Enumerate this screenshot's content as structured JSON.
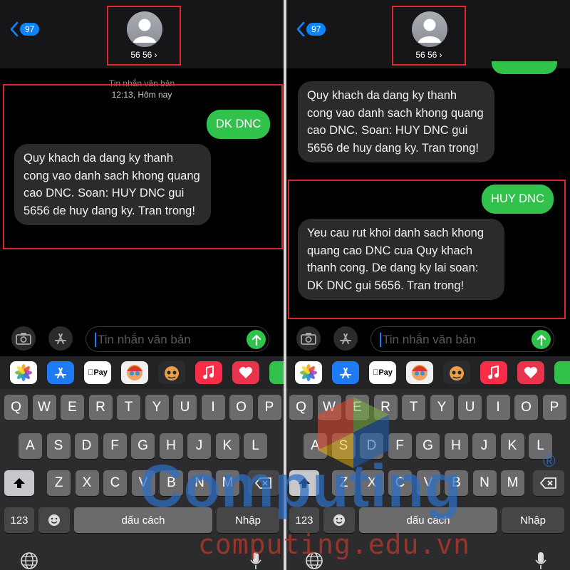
{
  "header": {
    "back_count": "97",
    "contact_name": "56 56 ›"
  },
  "conversation_meta": {
    "type_label": "Tin nhắn văn bản",
    "time": "12:13, Hôm nay"
  },
  "left_screen": {
    "messages": [
      {
        "direction": "outgoing",
        "text": "DK DNC"
      },
      {
        "direction": "incoming",
        "text": "Quy khach da dang ky thanh cong vao danh sach khong quang cao DNC. Soan: HUY DNC gui 5656 de huy dang ky. Tran trong!"
      }
    ]
  },
  "right_screen": {
    "messages": [
      {
        "direction": "incoming",
        "text": "Quy khach da dang ky thanh cong vao danh sach khong quang cao DNC. Soan: HUY DNC gui 5656 de huy dang ky. Tran trong!"
      },
      {
        "direction": "outgoing",
        "text": "HUY DNC"
      },
      {
        "direction": "incoming",
        "text": "Yeu cau rut khoi danh sach khong quang cao DNC cua Quy khach thanh cong. De dang ky lai soan: DK DNC gui 5656. Tran trong!"
      }
    ]
  },
  "composer": {
    "placeholder": "Tin nhắn văn bản"
  },
  "app_bar": {
    "applepay_label": "Pay"
  },
  "keyboard": {
    "row1": [
      "Q",
      "W",
      "E",
      "R",
      "T",
      "Y",
      "U",
      "I",
      "O",
      "P"
    ],
    "row2": [
      "A",
      "S",
      "D",
      "F",
      "G",
      "H",
      "J",
      "K",
      "L"
    ],
    "row3": [
      "Z",
      "X",
      "C",
      "V",
      "B",
      "N",
      "M"
    ],
    "numbers_key": "123",
    "space_label": "dấu cách",
    "return_label": "Nhập"
  },
  "watermark": {
    "logo_text": "Computing",
    "registered": "®",
    "url": "computing.edu.vn"
  },
  "colors": {
    "outgoing_bubble": "#30c24b",
    "incoming_bubble": "#2b2b2d",
    "highlight": "#d9262b",
    "link_blue": "#0a84ff"
  }
}
